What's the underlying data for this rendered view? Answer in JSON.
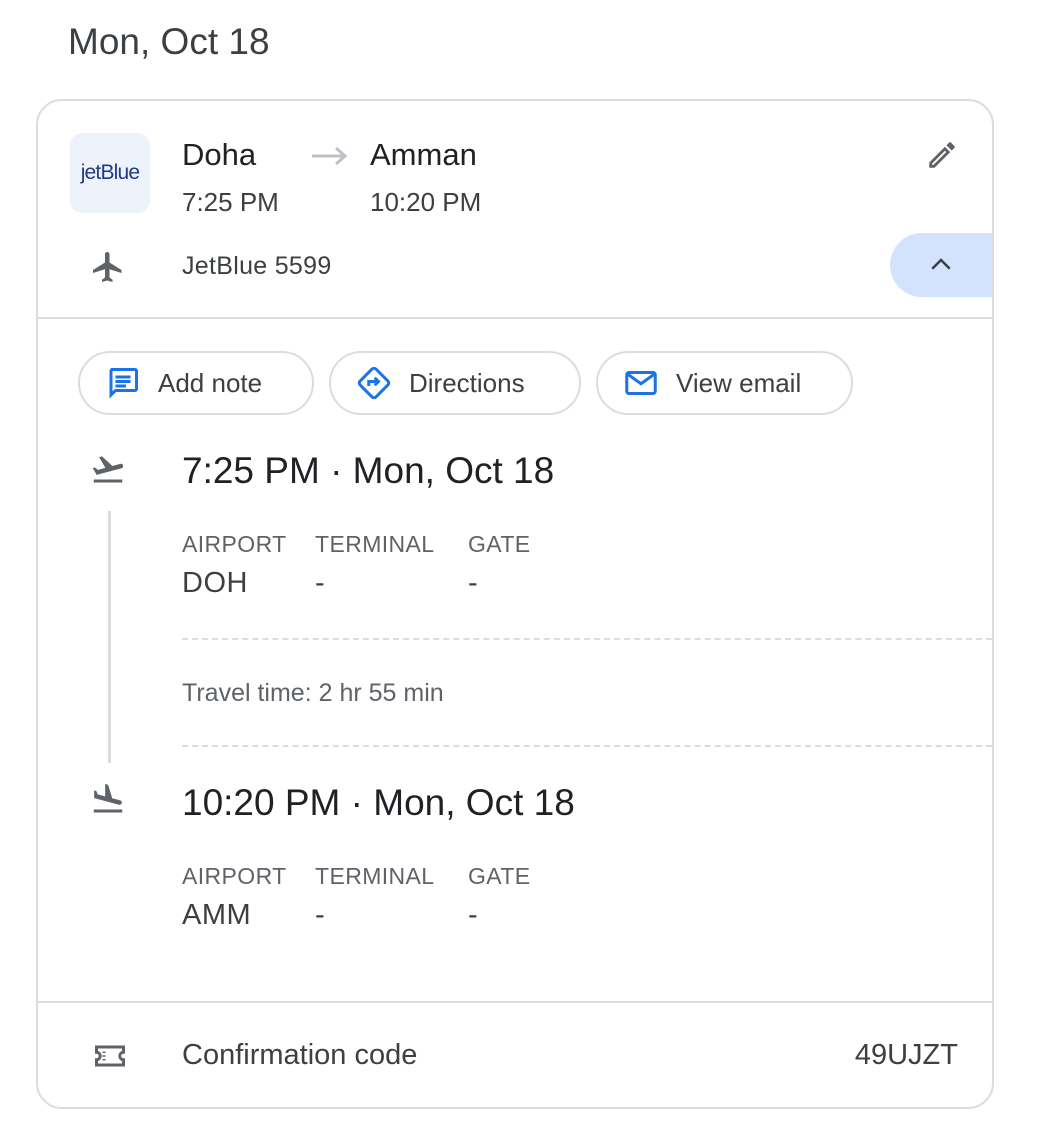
{
  "header": {
    "date": "Mon, Oct 18"
  },
  "flight": {
    "airline_logo_text": "jetBlue",
    "origin_city": "Doha",
    "destination_city": "Amman",
    "departure_time": "7:25 PM",
    "arrival_time": "10:20 PM",
    "flight_number": "JetBlue 5599"
  },
  "actions": {
    "add_note": "Add note",
    "directions": "Directions",
    "view_email": "View email"
  },
  "departure": {
    "title": "7:25 PM · Mon, Oct 18",
    "airport_label": "AIRPORT",
    "terminal_label": "TERMINAL",
    "gate_label": "GATE",
    "airport": "DOH",
    "terminal": "-",
    "gate": "-"
  },
  "travel_time": "Travel time: 2 hr 55 min",
  "arrival": {
    "title": "10:20 PM · Mon, Oct 18",
    "airport_label": "AIRPORT",
    "terminal_label": "TERMINAL",
    "gate_label": "GATE",
    "airport": "AMM",
    "terminal": "-",
    "gate": "-"
  },
  "confirmation": {
    "label": "Confirmation code",
    "code": "49UJZT"
  },
  "colors": {
    "accent_blue": "#1a73e8",
    "collapse_bg": "#d3e3fd",
    "border": "#dadce0"
  },
  "icons": [
    "airplane-icon",
    "edit-pencil-icon",
    "chevron-up-icon",
    "note-icon",
    "directions-icon",
    "email-icon",
    "takeoff-icon",
    "landing-icon",
    "ticket-icon"
  ]
}
